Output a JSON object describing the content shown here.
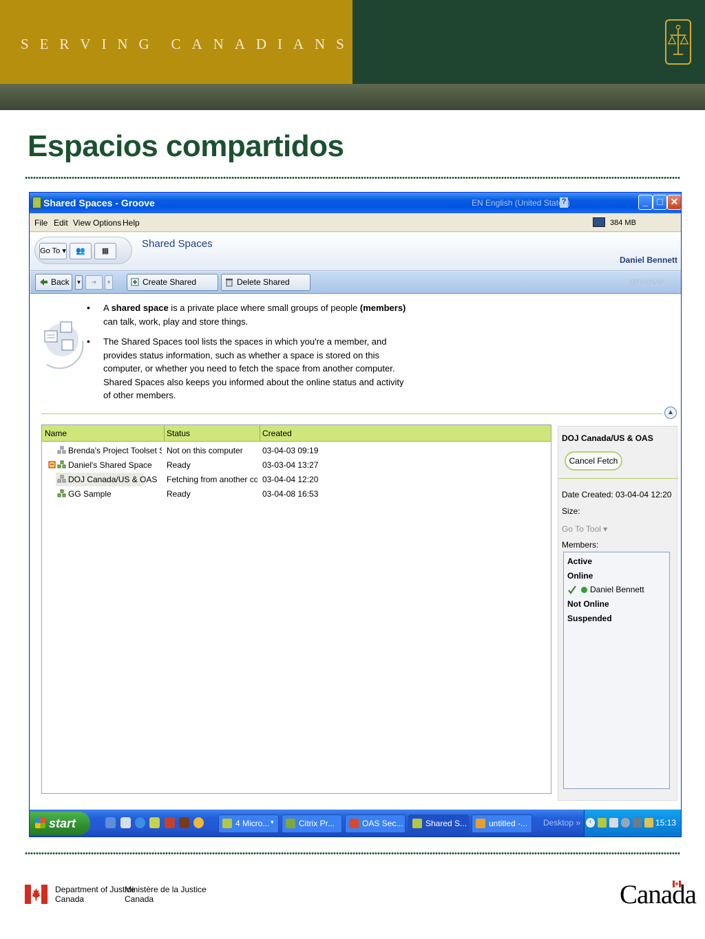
{
  "slide": {
    "banner_letters": [
      "S",
      "E",
      "R",
      "V",
      "I",
      "N",
      "G",
      " ",
      "C",
      "A",
      "N",
      "A",
      "D",
      "I",
      "A",
      "N",
      "S"
    ],
    "title": "Espacios compartidos",
    "footer": {
      "dept_en_line1": "Department of Justice",
      "dept_en_line2": "Canada",
      "dept_fr_line1": "Ministère de la Justice",
      "dept_fr_line2": "Canada",
      "wordmark": "Canada"
    },
    "colors": {
      "gold": "#b78f0e",
      "dark_green": "#1f4530",
      "title_green": "#1c5130"
    }
  },
  "window": {
    "title": "Shared Spaces - Groove",
    "language": "EN English (United States)",
    "menu": [
      "File",
      "Edit",
      "View",
      "Options",
      "Help"
    ],
    "memory": "384 MB",
    "header": {
      "goto_label": "Go To",
      "title": "Shared Spaces",
      "user": "Daniel Bennett"
    },
    "toolbar": {
      "back_label": "Back",
      "create_label": "Create Shared Space...",
      "delete_label": "Delete Shared Space",
      "logo": "groove"
    },
    "intro": {
      "bullet1_a": "A ",
      "bullet1_b": "shared space",
      "bullet1_c": " is a private place where small groups of people ",
      "bullet1_d": "(members)",
      "bullet1_e": " can talk, work, play and store things.",
      "bullet2": "The Shared Spaces tool lists the spaces in which you're a member, and provides status information, such as whether a space is stored on this computer, or whether you need to fetch the space from another computer. Shared Spaces also keeps you informed about the online status and activity of other members."
    },
    "table": {
      "columns": [
        "Name",
        "Status",
        "Created"
      ],
      "rows": [
        {
          "name": "Brenda's Project Toolset Sp...",
          "status": "Not on this computer",
          "created": "03-04-03 09:19"
        },
        {
          "name": "Daniel's Shared Space",
          "status": "Ready",
          "created": "03-03-04 13:27"
        },
        {
          "name": "DOJ Canada/US & OAS",
          "status": "Fetching from another co...",
          "created": "03-04-04 12:20"
        },
        {
          "name": "GG Sample",
          "status": "Ready",
          "created": "03-04-08 16:53"
        }
      ]
    },
    "details": {
      "title": "DOJ Canada/US & OAS",
      "cancel_label": "Cancel Fetch",
      "date_created": "Date Created: 03-04-04 12:20",
      "size": "Size:",
      "go_to_tool": "Go To Tool",
      "members_label": "Members:",
      "members": {
        "active": "Active",
        "online": "Online",
        "member_name": "Daniel Bennett",
        "not_online": "Not Online",
        "suspended": "Suspended"
      }
    },
    "taskbar": {
      "start": "start",
      "tasks": [
        "4 Micro...",
        "Citrix Pr...",
        "OAS Sec...",
        "Shared S...",
        "untitled -..."
      ],
      "desktop": "Desktop",
      "clock": "15:13"
    }
  }
}
